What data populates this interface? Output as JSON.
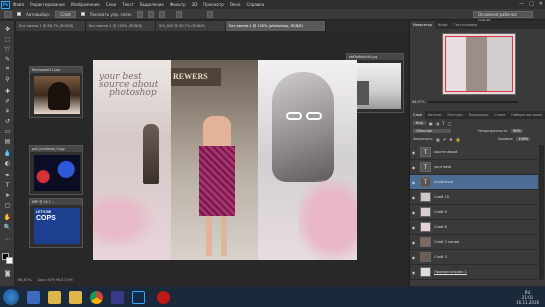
{
  "app": {
    "logo": "Ps",
    "menu": [
      "Файл",
      "Редактирование",
      "Изображение",
      "Слои",
      "Текст",
      "Выделение",
      "Фильтр",
      "3D",
      "Просмотр",
      "Окно",
      "Справка"
    ],
    "window_buttons": [
      "—",
      "□",
      "✕"
    ]
  },
  "options": {
    "auto_select_label": "Автовыбор:",
    "auto_select_value": "Слой",
    "show_controls_label": "Показать упр. элем.",
    "workspace": "Основная рабочая среда"
  },
  "tabs": [
    {
      "label": "Без имени-1 @ 66,7% (RGB/8)"
    },
    {
      "label": "Без имени-1 @ 100% (RGB/8)"
    },
    {
      "label": "SHI_800 @ 66,7% (RGB/8)"
    },
    {
      "label": "Без имени-1 @ 100% (photoshop, RGB/8)",
      "active": true
    }
  ],
  "float_windows": [
    {
      "title": "filenlopes011.psd"
    },
    {
      "title": "pull_lockdame_fr.jpg"
    },
    {
      "title": "KBP @ 16,7..."
    },
    {
      "title": "ebf3b6bbfe5b.jpg"
    }
  ],
  "cops_sign": {
    "line1": "LET'S BE",
    "line2": "COPS"
  },
  "main_doc": {
    "tagline_line1": "your best",
    "tagline_line2": "source about",
    "tagline_line3": "photoshop",
    "storefront": "REWERS"
  },
  "status": {
    "zoom": "66,67%",
    "doc_size": "Док: 879,9К/17,0М"
  },
  "navigator": {
    "tabs": [
      "Навигатор",
      "Инфо",
      "Гистограмма"
    ],
    "zoom": "66,67%"
  },
  "layers_panel": {
    "tabs": [
      "Слои",
      "Каналы",
      "Контуры",
      "Коррекция",
      "Стили",
      "Наборы настроек"
    ],
    "filter_label": "Вид",
    "blend_mode": "Обычные",
    "opacity_label": "Непрозрачность:",
    "opacity_value": "63%",
    "lock_label": "Закрепить:",
    "fill_label": "Заливка:",
    "fill_value": "100%",
    "layers": [
      {
        "name": "source about",
        "type": "text",
        "selected": false
      },
      {
        "name": "your best",
        "type": "text",
        "selected": false
      },
      {
        "name": "photoshop",
        "type": "text",
        "selected": true
      },
      {
        "name": "Слой 10",
        "type": "image",
        "selected": false
      },
      {
        "name": "Слой 9",
        "type": "image",
        "selected": false
      },
      {
        "name": "Слой 8",
        "type": "image",
        "selected": false
      },
      {
        "name": "Слой 3 копия",
        "type": "image",
        "selected": false
      },
      {
        "name": "Слой 3",
        "type": "image",
        "selected": false
      },
      {
        "name": "Прямоугольник 1",
        "type": "shape",
        "selected": false
      }
    ]
  },
  "taskbar": {
    "time": "21:01",
    "date": "16.11.2016",
    "lang": "RU"
  },
  "colors": {
    "accent": "#4b6d93",
    "bg_dark": "#282828",
    "panel": "#3a3a3a"
  }
}
